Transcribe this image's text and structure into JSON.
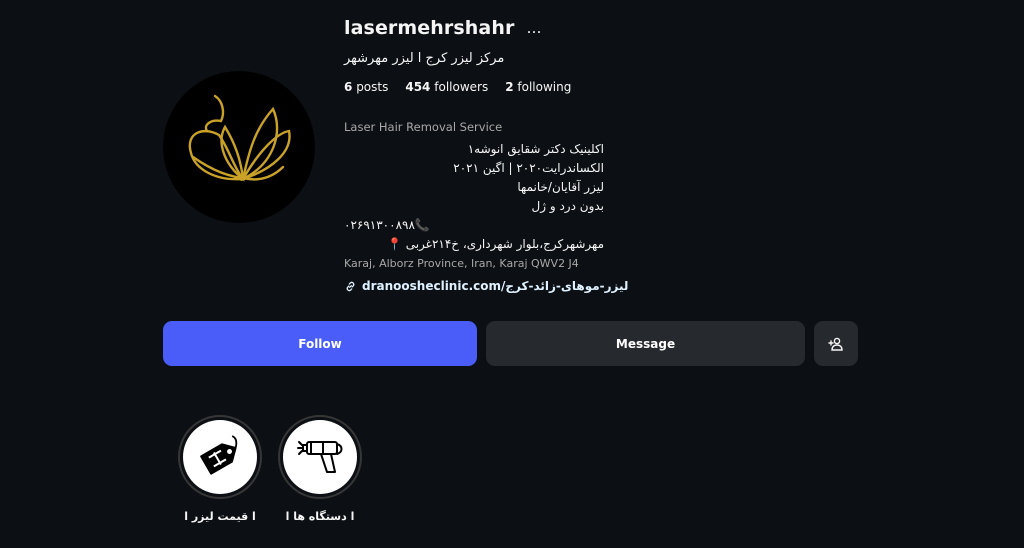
{
  "profile": {
    "username": "lasermehrshahr",
    "more_icon": "…",
    "full_name": "مرکز لیزر کرج ا لیزر مهرشهر",
    "stats": {
      "posts_count": "6",
      "posts_label": "posts",
      "followers_count": "454",
      "followers_label": "followers",
      "following_count": "2",
      "following_label": "following"
    },
    "category": "Laser Hair Removal Service",
    "bio_lines": [
      "اکلینیک دکتر شقایق انوشه۱",
      "الکساندرایت۲۰۲۰ | اگین ۲۰۲۱",
      "لیزر آقایان/خانمها",
      "بدون درد و ژل",
      "۰۲۶۹۱۳۰۰۸۹۸📞",
      "مهرشهرکرج،بلوار شهرداری، خ۲۱۴غربی 📍"
    ],
    "address": "Karaj, Alborz Province, Iran, Karaj QWV2 J4",
    "link_text": "dranoosheclinic.com/لیزر-موهای-زائد-کرج"
  },
  "actions": {
    "follow_label": "Follow",
    "message_label": "Message",
    "add_user_icon": "person-add-icon"
  },
  "highlights": [
    {
      "label": "ا قیمت لیزر ا",
      "icon": "price-tag-icon"
    },
    {
      "label": "ا دستگاه ها ا",
      "icon": "laser-device-icon"
    }
  ],
  "colors": {
    "background": "#0c1014",
    "follow_button": "#4a5df9",
    "secondary_button": "#262a2e",
    "avatar_gold": "#c9a227"
  }
}
